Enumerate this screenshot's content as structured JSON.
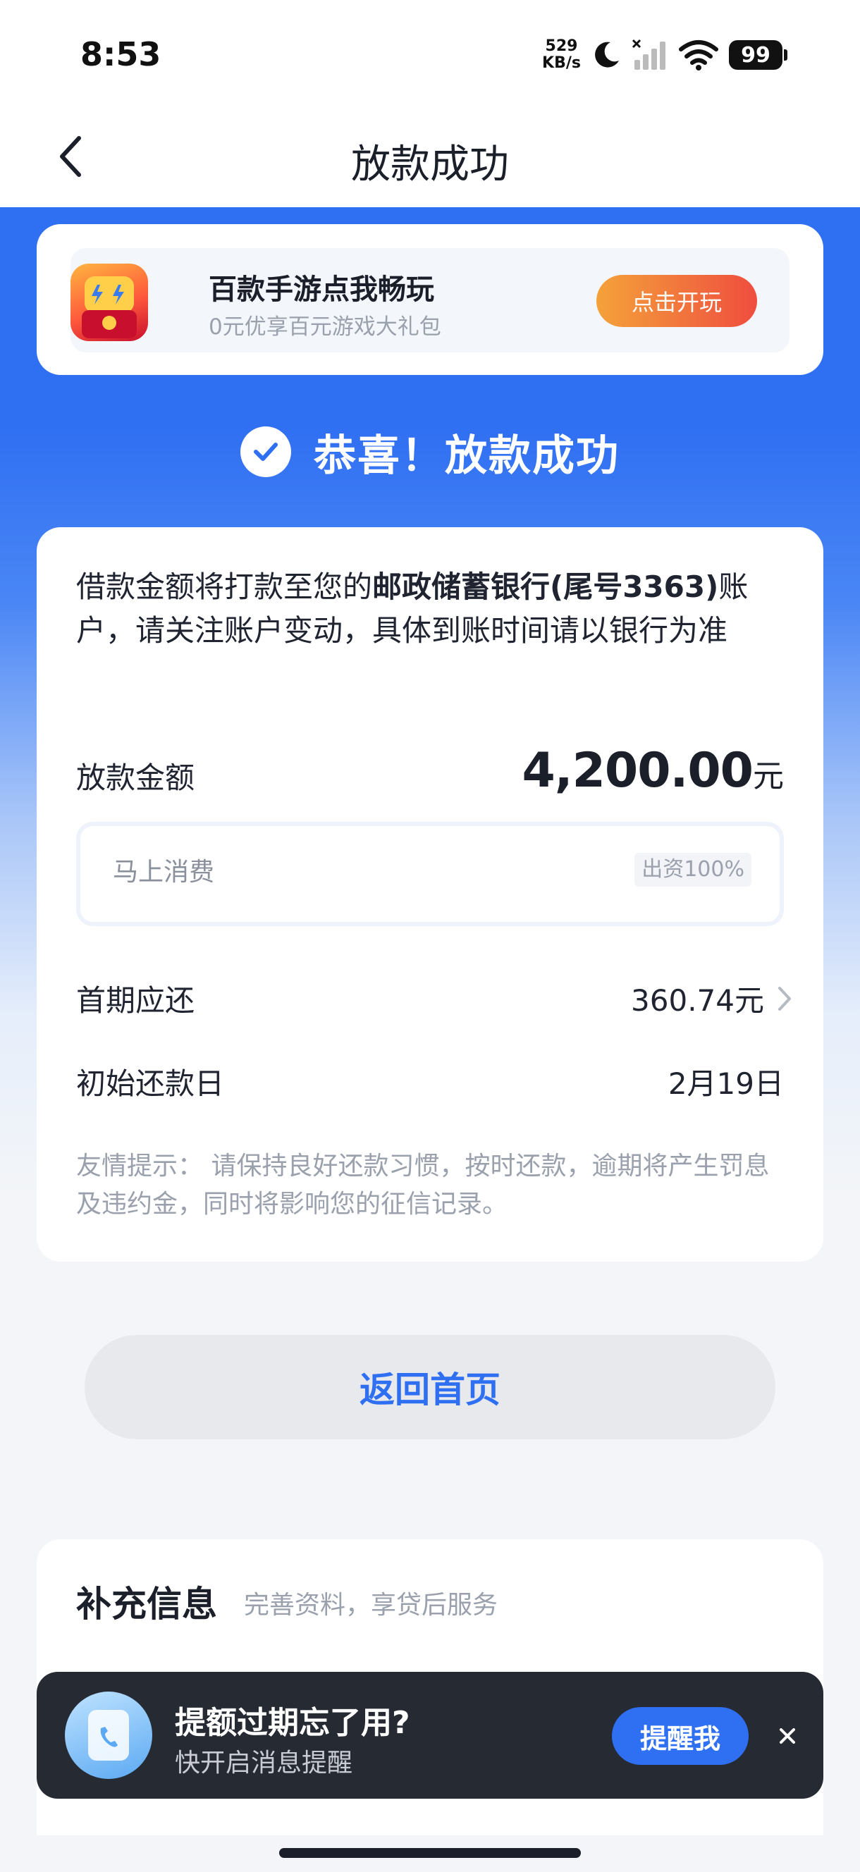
{
  "status_bar": {
    "time": "8:53",
    "net_speed_value": "529",
    "net_speed_unit": "KB/s",
    "battery": "99"
  },
  "nav": {
    "title": "放款成功"
  },
  "ad": {
    "title": "百款手游点我畅玩",
    "subtitle": "0元优享百元游戏大礼包",
    "button": "点击开玩"
  },
  "success": {
    "message": "恭喜！放款成功"
  },
  "notice": {
    "prefix": "借款金额将打款至您的",
    "bank": "邮政储蓄银行(尾号3363)",
    "suffix": "账户，请关注账户变动，具体到账时间请以银行为准"
  },
  "loan": {
    "amount_label": "放款金额",
    "amount": "4,200.00",
    "amount_unit": "元",
    "funder_name": "马上消费",
    "funder_share": "出资100%",
    "first_pay_label": "首期应还",
    "first_pay_value": "360.74元",
    "start_date_label": "初始还款日",
    "start_date_value": "2月19日",
    "tip": "友情提示： 请保持良好还款习惯，按时还款，逾期将产生罚息及违约金，同时将影响您的征信记录。"
  },
  "home_button": "返回首页",
  "extra": {
    "title": "补充信息",
    "subtitle": "完善资料，享贷后服务"
  },
  "toast": {
    "title": "提额过期忘了用?",
    "subtitle": "快开启消息提醒",
    "button": "提醒我"
  },
  "colors": {
    "brand_blue": "#2f6ff2",
    "ad_button_start": "#f4a23a",
    "ad_button_end": "#ef4d3f",
    "toast_bg": "#262a33"
  },
  "icons": [
    "back-arrow-icon",
    "moon-icon",
    "signal-icon",
    "wifi-icon",
    "battery-icon",
    "game-app-icon",
    "check-icon",
    "chevron-right-icon",
    "phone-icon",
    "close-icon"
  ]
}
